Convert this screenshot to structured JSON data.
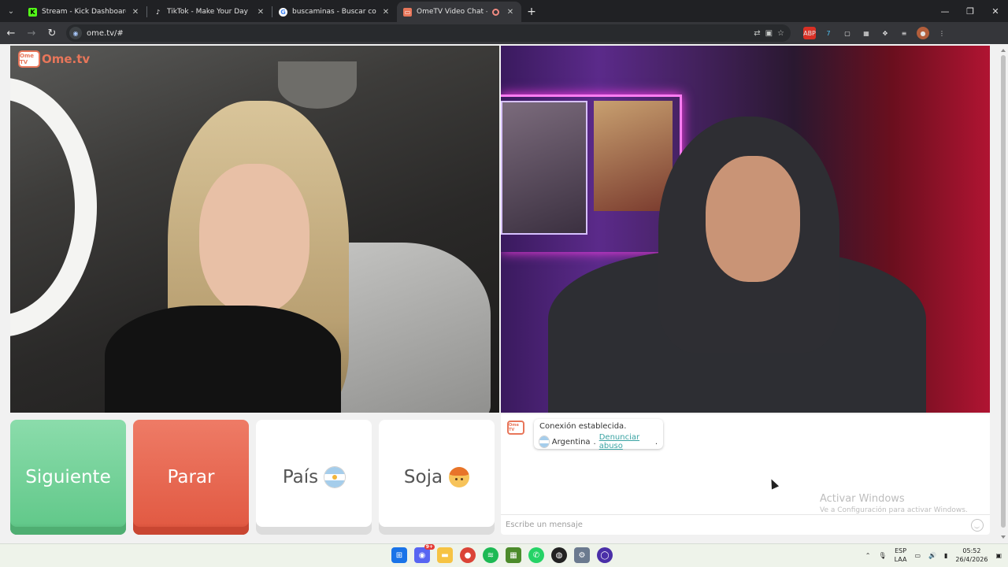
{
  "tabs": [
    {
      "title": "Stream - Kick Dashboard",
      "favicon": "kick-icon",
      "color": "#53fc18"
    },
    {
      "title": "TikTok - Make Your Day",
      "favicon": "tiktok-icon",
      "color": "#000000"
    },
    {
      "title": "buscaminas - Buscar con Goog",
      "favicon": "google-icon",
      "color": "#ffffff"
    },
    {
      "title": "OmeTV Video Chat — Alte",
      "favicon": "ometv-icon",
      "color": "#e8765a",
      "active": true
    }
  ],
  "address": {
    "url": "ome.tv/#"
  },
  "video": {
    "logo_text": "Ome.tv",
    "logo_badge": "Ome TV"
  },
  "buttons": {
    "next": "Siguiente",
    "stop": "Parar",
    "country": "País",
    "gender": "Soja"
  },
  "chat": {
    "system_badge": "Ome TV",
    "status": "Conexión establecida.",
    "country": "Argentina",
    "separator": " . ",
    "report_link": "Denunciar abuso",
    "report_suffix": ".",
    "input_placeholder": "Escribe un mensaje"
  },
  "watermark": {
    "title": "Activar Windows",
    "subtitle": "Ve a Configuración para activar Windows."
  },
  "taskbar": {
    "language": "ESP",
    "layout": "LAA",
    "time": "05:52",
    "date": "26/4/2026",
    "discord_badge": "9+"
  },
  "colors": {
    "next_button": "#63c98b",
    "stop_button": "#e25b44",
    "brand": "#e8765a",
    "link": "#3aa3a3"
  }
}
